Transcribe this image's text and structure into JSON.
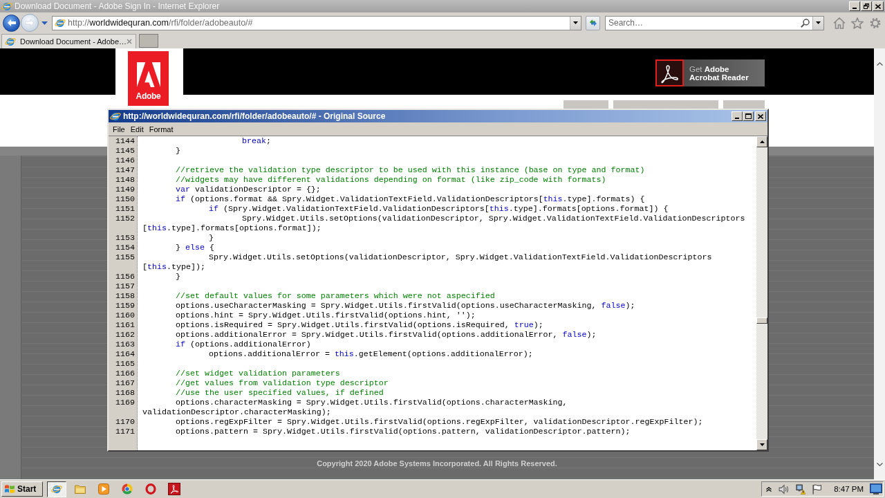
{
  "browser": {
    "title": "Download Document - Adobe Sign In - Internet Explorer",
    "active": false
  },
  "address_bar": {
    "url_scheme": "http://",
    "url_domain": "worldwidequran.com",
    "url_path": "/rfi/folder/adobeauto/#"
  },
  "search": {
    "placeholder": "Search…"
  },
  "tabs": [
    {
      "label": "Download Document - Adobe…",
      "selected": true
    }
  ],
  "page": {
    "header": {
      "logo_text": "Adobe",
      "acrobat_button": {
        "line_1": "Get **Adobe**",
        "line_2": "Acrobat Reader"
      }
    },
    "footer": {
      "copyright": "Copyright 2020 Adobe Systems Incorporated. All Rights Reserved."
    }
  },
  "source_window": {
    "title": "http://worldwidequran.com/rfi/folder/adobeauto/# - Original Source",
    "active": true,
    "menu": [
      "File",
      "Edit",
      "Format"
    ],
    "lines": [
      {
        "number": "1144",
        "tokens": [
          {
            "kind": "keyword",
            "text": "\t\t\tbreak"
          },
          {
            "kind": "plain",
            "text": ";"
          }
        ]
      },
      {
        "number": "1145",
        "tokens": [
          {
            "kind": "plain",
            "text": "\t}"
          }
        ]
      },
      {
        "number": "1146"
      },
      {
        "number": "1147",
        "tokens": [
          {
            "kind": "comment",
            "text": "\t//retrieve the validation type descriptor to be used with this instance (base on type and format)"
          }
        ]
      },
      {
        "number": "1148",
        "tokens": [
          {
            "kind": "comment",
            "text": "\t//widgets may have different validations depending on format (like zip_code with formats)"
          }
        ]
      },
      {
        "number": "1149",
        "tokens": [
          {
            "kind": "keyword",
            "text": "\tvar"
          },
          {
            "kind": "plain",
            "text": " validationDescriptor = {};"
          }
        ]
      },
      {
        "number": "1150",
        "tokens": [
          {
            "kind": "keyword",
            "text": "\tif"
          },
          {
            "kind": "plain",
            "text": " (options.format && Spry.Widget.ValidationTextField.ValidationDescriptors["
          },
          {
            "kind": "keyword",
            "text": "this"
          },
          {
            "kind": "plain",
            "text": ".type].formats) {"
          }
        ]
      },
      {
        "number": "1151",
        "tokens": [
          {
            "kind": "keyword",
            "text": "\t\tif"
          },
          {
            "kind": "plain",
            "text": " (Spry.Widget.ValidationTextField.ValidationDescriptors["
          },
          {
            "kind": "keyword",
            "text": "this"
          },
          {
            "kind": "plain",
            "text": ".type].formats[options.format]) {"
          }
        ]
      },
      {
        "number": "1152",
        "tokens": [
          {
            "kind": "plain",
            "text": "\t\t\tSpry.Widget.Utils.setOptions(validationDescriptor, Spry.Widget.ValidationTextField.ValidationDescriptors"
          }
        ]
      },
      {
        "tokens": [
          {
            "kind": "plain",
            "text": "["
          },
          {
            "kind": "keyword",
            "text": "this"
          },
          {
            "kind": "plain",
            "text": ".type].formats[options.format]);"
          }
        ]
      },
      {
        "number": "1153",
        "tokens": [
          {
            "kind": "plain",
            "text": "\t\t}"
          }
        ]
      },
      {
        "number": "1154",
        "tokens": [
          {
            "kind": "plain",
            "text": "\t} "
          },
          {
            "kind": "keyword",
            "text": "else"
          },
          {
            "kind": "plain",
            "text": " {"
          }
        ]
      },
      {
        "number": "1155",
        "tokens": [
          {
            "kind": "plain",
            "text": "\t\tSpry.Widget.Utils.setOptions(validationDescriptor, Spry.Widget.ValidationTextField.ValidationDescriptors"
          }
        ]
      },
      {
        "tokens": [
          {
            "kind": "plain",
            "text": "["
          },
          {
            "kind": "keyword",
            "text": "this"
          },
          {
            "kind": "plain",
            "text": ".type]);"
          }
        ]
      },
      {
        "number": "1156",
        "tokens": [
          {
            "kind": "plain",
            "text": "\t}"
          }
        ]
      },
      {
        "number": "1157"
      },
      {
        "number": "1158",
        "tokens": [
          {
            "kind": "comment",
            "text": "\t//set default values for some parameters which were not aspecified"
          }
        ]
      },
      {
        "number": "1159",
        "tokens": [
          {
            "kind": "plain",
            "text": "\toptions.useCharacterMasking = Spry.Widget.Utils.firstValid(options.useCharacterMasking, "
          },
          {
            "kind": "keyword",
            "text": "false"
          },
          {
            "kind": "plain",
            "text": ");"
          }
        ]
      },
      {
        "number": "1160",
        "tokens": [
          {
            "kind": "plain",
            "text": "\toptions.hint = Spry.Widget.Utils.firstValid(options.hint, '');"
          }
        ]
      },
      {
        "number": "1161",
        "tokens": [
          {
            "kind": "plain",
            "text": "\toptions.isRequired = Spry.Widget.Utils.firstValid(options.isRequired, "
          },
          {
            "kind": "keyword",
            "text": "true"
          },
          {
            "kind": "plain",
            "text": ");"
          }
        ]
      },
      {
        "number": "1162",
        "tokens": [
          {
            "kind": "plain",
            "text": "\toptions.additionalError = Spry.Widget.Utils.firstValid(options.additionalError, "
          },
          {
            "kind": "keyword",
            "text": "false"
          },
          {
            "kind": "plain",
            "text": ");"
          }
        ]
      },
      {
        "number": "1163",
        "tokens": [
          {
            "kind": "keyword",
            "text": "\tif"
          },
          {
            "kind": "plain",
            "text": " (options.additionalError)"
          }
        ]
      },
      {
        "number": "1164",
        "tokens": [
          {
            "kind": "plain",
            "text": "\t\toptions.additionalError = "
          },
          {
            "kind": "keyword",
            "text": "this"
          },
          {
            "kind": "plain",
            "text": ".getElement(options.additionalError);"
          }
        ]
      },
      {
        "number": "1165"
      },
      {
        "number": "1166",
        "tokens": [
          {
            "kind": "comment",
            "text": "\t//set widget validation parameters"
          }
        ]
      },
      {
        "number": "1167",
        "tokens": [
          {
            "kind": "comment",
            "text": "\t//get values from validation type descriptor"
          }
        ]
      },
      {
        "number": "1168",
        "tokens": [
          {
            "kind": "comment",
            "text": "\t//use the user specified values, if defined"
          }
        ]
      },
      {
        "number": "1169",
        "tokens": [
          {
            "kind": "plain",
            "text": "\toptions.characterMasking = Spry.Widget.Utils.firstValid(options.characterMasking,"
          }
        ]
      },
      {
        "tokens": [
          {
            "kind": "plain",
            "text": "validationDescriptor.characterMasking);"
          }
        ]
      },
      {
        "number": "1170",
        "tokens": [
          {
            "kind": "plain",
            "text": "\toptions.regExpFilter = Spry.Widget.Utils.firstValid(options.regExpFilter, validationDescriptor.regExpFilter);"
          }
        ]
      },
      {
        "number": "1171",
        "tokens": [
          {
            "kind": "plain",
            "text": "\toptions.pattern = Spry.Widget.Utils.firstValid(options.pattern, validationDescriptor.pattern);"
          }
        ]
      }
    ]
  },
  "taskbar": {
    "start": "Start",
    "buttons": [
      {
        "selected": true
      },
      {
        "selected": false
      },
      {
        "selected": false
      },
      {
        "selected": false
      },
      {
        "selected": false
      },
      {
        "selected": false
      }
    ],
    "clock": "8:47 PM"
  }
}
